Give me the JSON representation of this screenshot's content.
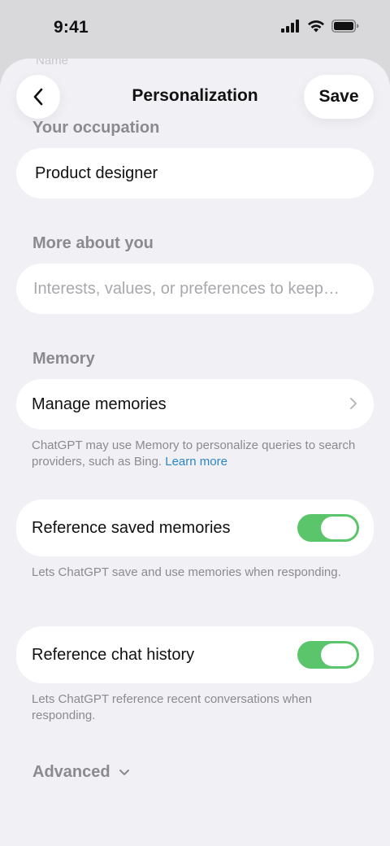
{
  "status_bar": {
    "time": "9:41"
  },
  "header": {
    "title": "Personalization",
    "save_label": "Save",
    "ghost_label": "Name"
  },
  "occupation": {
    "label": "Your occupation",
    "value": "Product designer"
  },
  "more_about": {
    "label": "More about you",
    "placeholder": "Interests, values, or preferences to keep…"
  },
  "memory": {
    "label": "Memory",
    "manage_label": "Manage memories",
    "helper_text": "ChatGPT may use Memory to personalize queries to search providers, such as Bing.",
    "helper_link": "Learn more"
  },
  "reference_saved": {
    "label": "Reference saved memories",
    "enabled": true,
    "helper": "Lets ChatGPT save and use memories when responding."
  },
  "reference_chat": {
    "label": "Reference chat history",
    "enabled": true,
    "helper": "Lets ChatGPT reference recent conversations when responding."
  },
  "advanced": {
    "label": "Advanced"
  },
  "colors": {
    "toggle_on": "#5ac56a",
    "link": "#2c86c6",
    "background": "#f0f0f5"
  },
  "icons": [
    "back-chevron-icon",
    "chevron-right-icon",
    "chevron-down-icon",
    "cellular-icon",
    "wifi-icon",
    "battery-icon"
  ]
}
